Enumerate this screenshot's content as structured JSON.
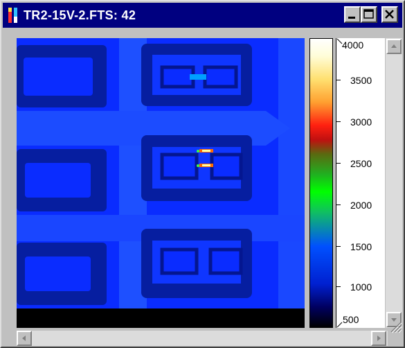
{
  "window": {
    "title": "TR2-15V-2.FTS: 42",
    "controls": {
      "minimize_icon": "minimize-icon",
      "maximize_icon": "maximize-icon",
      "close_icon": "close-icon"
    }
  },
  "colors": {
    "titlebar": "#000080",
    "image_background": "#0a2cff",
    "image_bottom_band": "#000000",
    "hotspot": "#ff6a00"
  },
  "colorbar": {
    "tick_labels": [
      "4000",
      "3500",
      "3000",
      "2500",
      "2000",
      "1500",
      "1000",
      "500"
    ]
  },
  "scrollbars": {
    "vertical": {
      "up_icon": "arrow-up-icon",
      "down_icon": "arrow-down-icon"
    },
    "horizontal": {
      "left_icon": "arrow-left-icon",
      "right_icon": "arrow-right-icon"
    }
  }
}
